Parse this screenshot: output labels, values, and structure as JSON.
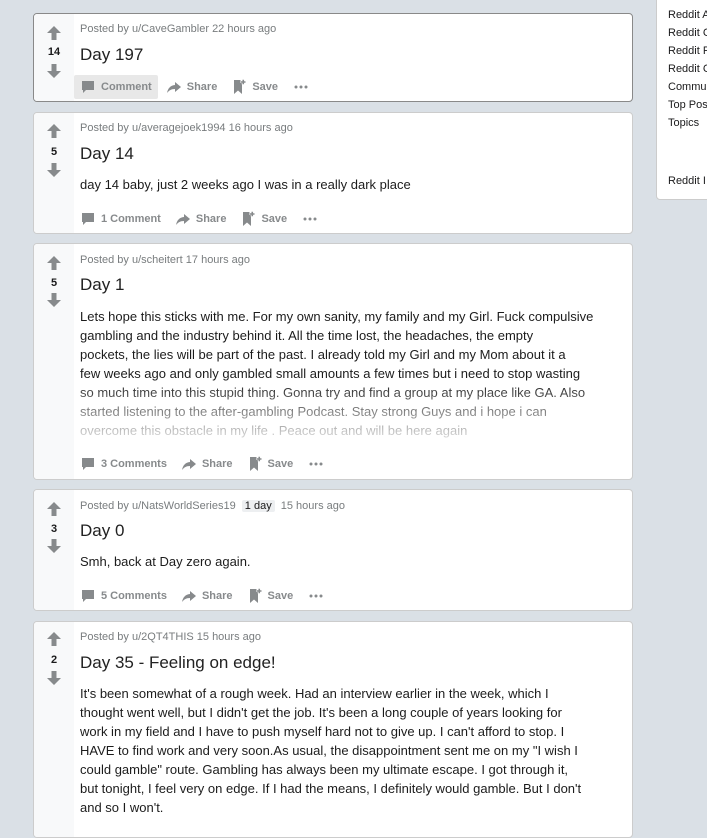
{
  "labels": {
    "share": "Share",
    "save": "Save",
    "comment": "Comment",
    "comments": "Comments"
  },
  "sidebar": {
    "links": [
      "Reddit A",
      "Reddit C",
      "Reddit R",
      "Reddit C",
      "Commu",
      "Top Pos",
      "Topics",
      "Reddit I"
    ]
  },
  "posts": [
    {
      "score": "14",
      "meta": "Posted by u/CaveGambler 22 hours ago",
      "title": "Day 197",
      "comment_label": "Comment"
    },
    {
      "score": "5",
      "meta": "Posted by u/averagejoek1994 16 hours ago",
      "title": "Day 14",
      "body": "day 14 baby, just 2 weeks ago I was in a really dark place",
      "comment_count": "1",
      "comment_label": "Comment"
    },
    {
      "score": "5",
      "meta": "Posted by u/scheitert 17 hours ago",
      "title": "Day 1",
      "body_lines": [
        "Lets hope this sticks with me. For my own sanity, my family and my Girl. Fuck compulsive",
        "gambling and the industry behind it. All the time lost, the headaches, the empty",
        "pockets, the lies will be part of the past. I already told my Girl and my Mom about it a",
        "few weeks ago and only gambled small amounts a few times but i need to stop wasting",
        "so much time into this stupid thing. Gonna try and find a group at my place like GA. Also",
        "started listening to the after-gambling Podcast. Stay strong Guys and i hope i can",
        "overcome this obstacle in my life . Peace out and will be here again"
      ],
      "comment_count": "3",
      "comment_label": "Comments"
    },
    {
      "score": "3",
      "meta_user": "Posted by u/NatsWorldSeries19",
      "flair": "1 day",
      "meta_time": "15 hours ago",
      "title": "Day 0",
      "body": "Smh, back at Day zero again.",
      "comment_count": "5",
      "comment_label": "Comments"
    },
    {
      "score": "2",
      "meta": "Posted by u/2QT4THIS 15 hours ago",
      "title": "Day 35 - Feeling on edge!",
      "body_lines": [
        "It's been somewhat of a rough week. Had an interview earlier in the week, which I",
        "thought went well, but I didn't get the job. It's been a long couple of years looking for",
        "work in my field and I have to push myself hard not to give up. I can't afford to stop. I",
        "HAVE to find work and very soon.As usual, the disappointment sent me on my \"I wish I",
        "could gamble\" route. Gambling has always been my ultimate escape. I got through it,",
        "but tonight, I feel very on edge. If I had the means, I definitely would gamble. But I don't",
        "and so I won't."
      ]
    }
  ]
}
